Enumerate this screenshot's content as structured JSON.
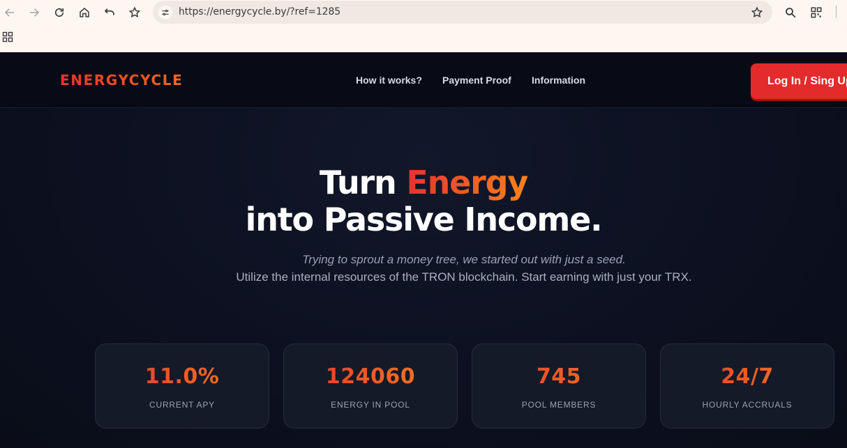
{
  "browser": {
    "url": "https://energycycle.by/?ref=1285",
    "icons": [
      "back-arrow-icon",
      "forward-arrow-icon",
      "reload-icon",
      "home-icon",
      "undo-icon",
      "bookmark-star-icon",
      "site-info-icon",
      "bookmark-this-page-icon",
      "zoom-search-icon",
      "qr-code-icon",
      "apps-grid-icon"
    ]
  },
  "nav": {
    "logo": "ENERGYCYCLE",
    "links": [
      "How it works?",
      "Payment Proof",
      "Information"
    ],
    "login_label": "Log In / Sing Up"
  },
  "hero": {
    "title_word1": "Turn",
    "title_accent": "Energy",
    "title_line2": "into Passive Income.",
    "subtitle_italic": "Trying to sprout a money tree, we started out with just a seed.",
    "subtitle": "Utilize the internal resources of the TRON blockchain. Start earning with just your TRX."
  },
  "stats": [
    {
      "value": "11.0%",
      "label": "CURRENT APY"
    },
    {
      "value": "124060",
      "label": "ENERGY IN POOL"
    },
    {
      "value": "745",
      "label": "POOL MEMBERS"
    },
    {
      "value": "24/7",
      "label": "HOURLY ACCRUALS"
    }
  ],
  "colors": {
    "accent_red": "#e6332e",
    "accent_orange": "#f5821c",
    "page_bg": "#0b0e1a",
    "card_bg": "#151a28",
    "login_button": "#e42b2b"
  }
}
